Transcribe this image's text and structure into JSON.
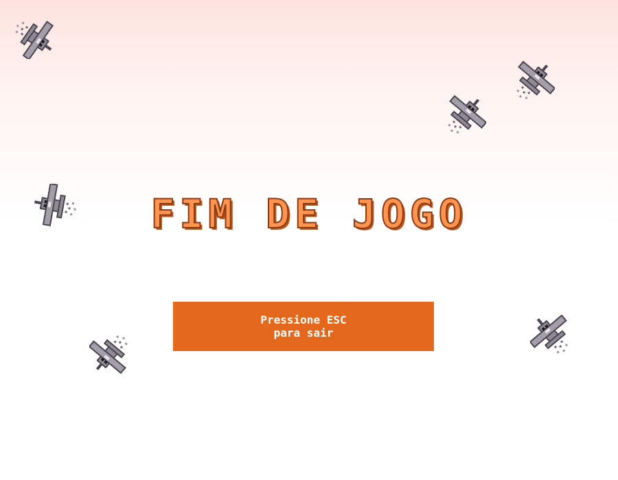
{
  "game": {
    "title": "FIM DE JOGO",
    "exit_message": "Pressione ESC\npara sair",
    "sprite": "pixel-bomber-plane-icon"
  },
  "colors": {
    "title_fill": "#ff9451",
    "title_outline": "#8a3a12",
    "panel_bg": "#e4681b",
    "panel_text": "#ffffff",
    "plane_body": "#8f8a93",
    "plane_outline": "#4a4550"
  }
}
